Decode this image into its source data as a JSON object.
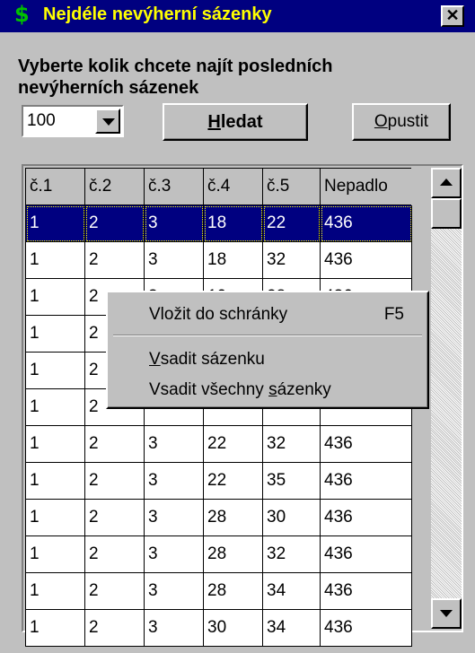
{
  "window": {
    "title": "Nejdéle nevýherní sázenky",
    "icon": "dollar-sign-icon",
    "close_label": "✕"
  },
  "prompt": {
    "line1": "Vyberte kolik chcete najít posledních",
    "line2": "nevýherních sázenek"
  },
  "count_combo": {
    "value": "100"
  },
  "buttons": {
    "search_accel": "H",
    "search_rest": "ledat",
    "quit_accel": "O",
    "quit_rest": "pustit"
  },
  "grid": {
    "headers": [
      "č.1",
      "č.2",
      "č.3",
      "č.4",
      "č.5",
      "Nepadlo"
    ],
    "rows": [
      [
        "1",
        "2",
        "3",
        "18",
        "22",
        "436"
      ],
      [
        "1",
        "2",
        "3",
        "18",
        "32",
        "436"
      ],
      [
        "1",
        "2",
        "3",
        "19",
        "28",
        "436"
      ],
      [
        "1",
        "2",
        "",
        "",
        "",
        ""
      ],
      [
        "1",
        "2",
        "",
        "",
        "",
        ""
      ],
      [
        "1",
        "2",
        "",
        "",
        "",
        ""
      ],
      [
        "1",
        "2",
        "3",
        "22",
        "32",
        "436"
      ],
      [
        "1",
        "2",
        "3",
        "22",
        "35",
        "436"
      ],
      [
        "1",
        "2",
        "3",
        "28",
        "30",
        "436"
      ],
      [
        "1",
        "2",
        "3",
        "28",
        "32",
        "436"
      ],
      [
        "1",
        "2",
        "3",
        "28",
        "34",
        "436"
      ],
      [
        "1",
        "2",
        "3",
        "30",
        "34",
        "436"
      ]
    ],
    "selected_row": 0
  },
  "context_menu": {
    "copy_label": "Vložit do schránky",
    "copy_shortcut": "F5",
    "bet_accel": "V",
    "bet_rest": "sadit sázenku",
    "bet_all_pre": "Vsadit všechny ",
    "bet_all_accel": "s",
    "bet_all_post": "ázenky"
  },
  "colors": {
    "title_bg": "#000080",
    "title_text": "#ffff00",
    "selection": "#000080",
    "face": "#c0c0c0"
  }
}
